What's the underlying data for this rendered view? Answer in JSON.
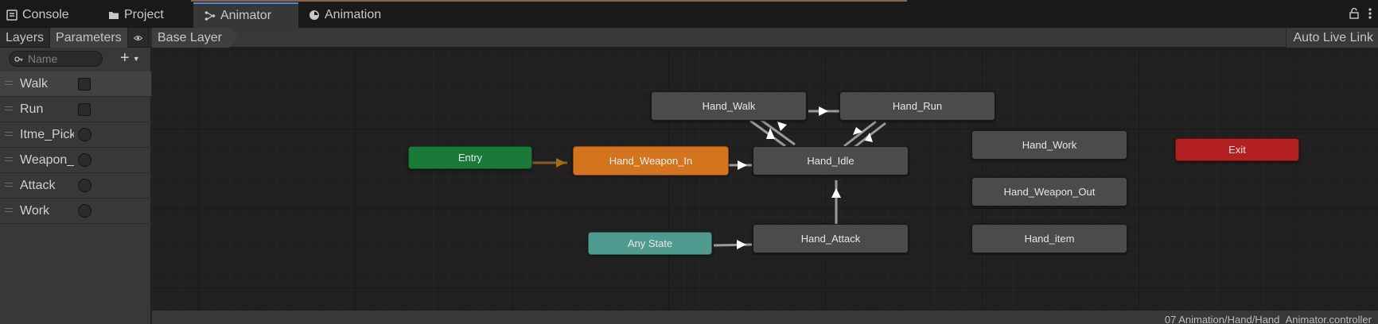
{
  "tabs": [
    {
      "label": "Console",
      "icon": "console-icon"
    },
    {
      "label": "Project",
      "icon": "folder-icon"
    },
    {
      "label": "Animator",
      "icon": "animator-icon",
      "active": true
    },
    {
      "label": "Animation",
      "icon": "clock-icon"
    }
  ],
  "window_icons": {
    "lock": "🔓",
    "menu": "⋮"
  },
  "left_panel": {
    "tabs": [
      "Layers",
      "Parameters"
    ],
    "search_placeholder": "Name",
    "add_label": "+",
    "parameters": [
      {
        "name": "Walk",
        "type": "bool"
      },
      {
        "name": "Run",
        "type": "bool"
      },
      {
        "name": "Itme_Pick",
        "type": "trigger"
      },
      {
        "name": "Weapon_Change",
        "type": "trigger"
      },
      {
        "name": "Attack",
        "type": "trigger"
      },
      {
        "name": "Work",
        "type": "trigger"
      }
    ]
  },
  "graph": {
    "breadcrumb": "Base Layer",
    "auto_live_link": "Auto Live Link",
    "status_path": "07 Animation/Hand/Hand_Animator.controller",
    "states": {
      "entry": "Entry",
      "hand_weapon_in": "Hand_Weapon_In",
      "hand_walk": "Hand_Walk",
      "hand_run": "Hand_Run",
      "hand_idle": "Hand_Idle",
      "hand_work": "Hand_Work",
      "hand_weapon_out": "Hand_Weapon_Out",
      "hand_item": "Hand_item",
      "any_state": "Any State",
      "hand_attack": "Hand_Attack",
      "exit": "Exit"
    },
    "colors": {
      "entry": "#1a7a37",
      "default_state": "#d4741c",
      "any_state": "#509b8f",
      "exit": "#b41f1f",
      "state": "#4b4b4b"
    }
  }
}
